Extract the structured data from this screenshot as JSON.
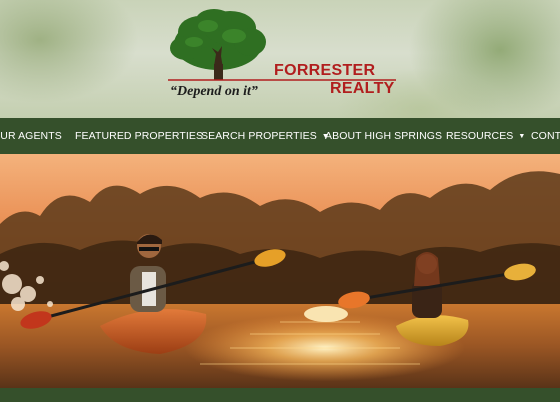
{
  "brand": {
    "name_line1": "FORRESTER",
    "name_line2": "REALTY",
    "tagline": "“Depend on it”",
    "logo_icon": "oak-tree-icon"
  },
  "nav": {
    "items": [
      {
        "label": "OUR AGENTS",
        "dropdown": false
      },
      {
        "label": "FEATURED PROPERTIES",
        "dropdown": false
      },
      {
        "label": "SEARCH PROPERTIES",
        "dropdown": true
      },
      {
        "label": "ABOUT HIGH SPRINGS",
        "dropdown": false
      },
      {
        "label": "RESOURCES",
        "dropdown": true
      },
      {
        "label": "CONTA",
        "dropdown": false
      }
    ],
    "caret_glyph": "▼"
  },
  "hero": {
    "image": "kayakers-at-sunset"
  },
  "colors": {
    "nav_bg": "#35502b",
    "brand_red": "#b11e1e"
  }
}
